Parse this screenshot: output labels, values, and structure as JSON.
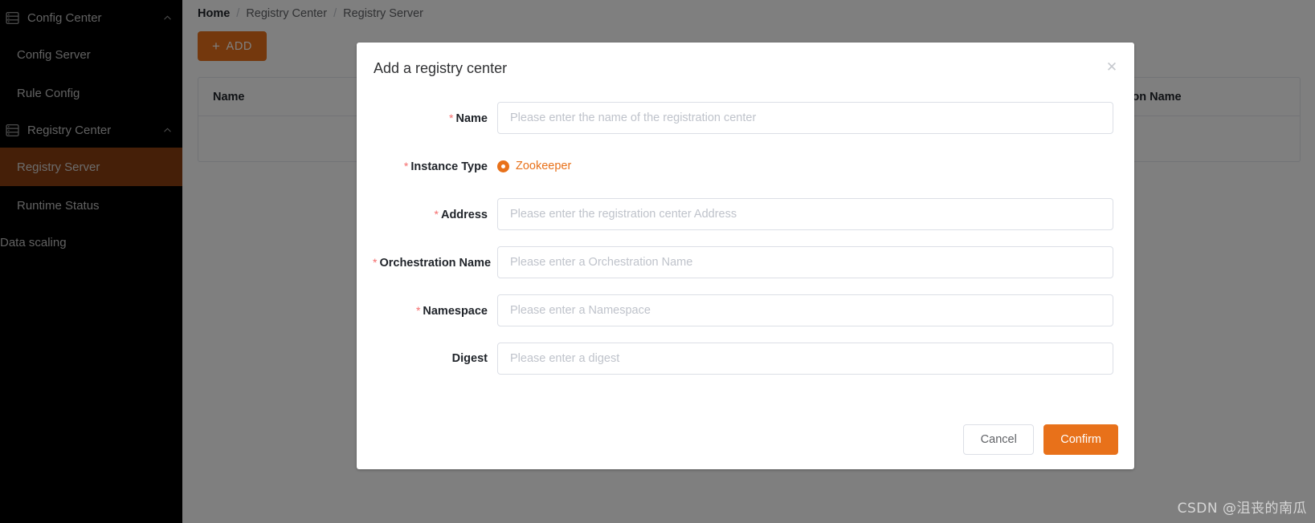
{
  "sidebar": {
    "groups": [
      {
        "label": "Config Center",
        "icon": "server-stack-icon",
        "caret": "chevron-up-icon",
        "items": [
          {
            "label": "Config Server",
            "active": false
          },
          {
            "label": "Rule Config",
            "active": false
          }
        ]
      },
      {
        "label": "Registry Center",
        "icon": "server-stack-icon",
        "caret": "chevron-up-icon",
        "items": [
          {
            "label": "Registry Server",
            "active": true
          },
          {
            "label": "Runtime Status",
            "active": false
          }
        ]
      }
    ],
    "plain_items": [
      {
        "label": "Data scaling"
      }
    ]
  },
  "breadcrumb": {
    "items": [
      "Home",
      "Registry Center",
      "Registry Server"
    ],
    "separator": "/"
  },
  "toolbar": {
    "add_label": "ADD",
    "add_icon": "plus-icon"
  },
  "table": {
    "columns": [
      "Name",
      "Orchestration Name"
    ],
    "visible_right_column_fragment": "hestration Name",
    "rows": [
      {}
    ]
  },
  "modal": {
    "title": "Add a registry center",
    "close_icon": "close-icon",
    "fields": [
      {
        "label": "Name",
        "required": true,
        "type": "text",
        "value": "",
        "placeholder": "Please enter the name of the registration center"
      },
      {
        "label": "Instance Type",
        "required": true,
        "type": "radio",
        "selected": "Zookeeper",
        "options": [
          "Zookeeper"
        ]
      },
      {
        "label": "Address",
        "required": true,
        "type": "text",
        "value": "",
        "placeholder": "Please enter the registration center Address"
      },
      {
        "label": "Orchestration Name",
        "required": true,
        "type": "text",
        "value": "",
        "placeholder": "Please enter a Orchestration Name"
      },
      {
        "label": "Namespace",
        "required": true,
        "type": "text",
        "value": "",
        "placeholder": "Please enter a Namespace"
      },
      {
        "label": "Digest",
        "required": false,
        "type": "text",
        "value": "",
        "placeholder": "Please enter a digest"
      }
    ],
    "cancel_label": "Cancel",
    "confirm_label": "Confirm"
  },
  "watermark": {
    "text": "CSDN @沮丧的南瓜"
  },
  "colors": {
    "accent": "#e8711a",
    "sidebar_bg": "#000000",
    "sidebar_active": "#8a3e10",
    "required_star": "#f56c6c",
    "overlay": "rgba(0,0,0,0.5)"
  }
}
